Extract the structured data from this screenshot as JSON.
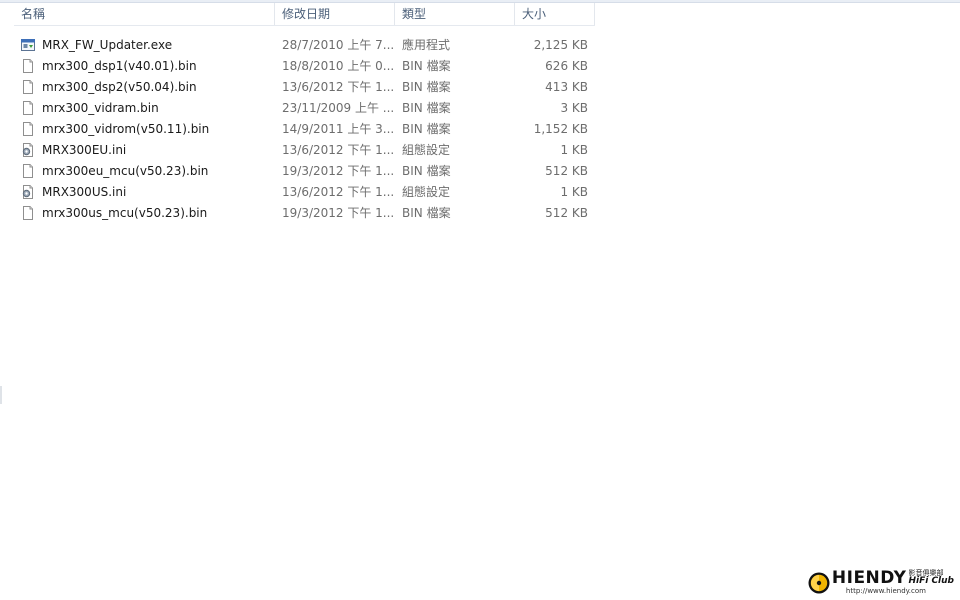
{
  "columns": {
    "name": "名稱",
    "date": "修改日期",
    "type": "類型",
    "size": "大小",
    "sort_indicator": "^"
  },
  "files": [
    {
      "name": "MRX_FW_Updater.exe",
      "date": "28/7/2010 上午 7...",
      "type": "應用程式",
      "size": "2,125 KB",
      "icon": "exe-icon"
    },
    {
      "name": "mrx300_dsp1(v40.01).bin",
      "date": "18/8/2010 上午 0...",
      "type": "BIN 檔案",
      "size": "626 KB",
      "icon": "file-icon"
    },
    {
      "name": "mrx300_dsp2(v50.04).bin",
      "date": "13/6/2012 下午 1...",
      "type": "BIN 檔案",
      "size": "413 KB",
      "icon": "file-icon"
    },
    {
      "name": "mrx300_vidram.bin",
      "date": "23/11/2009 上午 ...",
      "type": "BIN 檔案",
      "size": "3 KB",
      "icon": "file-icon"
    },
    {
      "name": "mrx300_vidrom(v50.11).bin",
      "date": "14/9/2011 上午 3...",
      "type": "BIN 檔案",
      "size": "1,152 KB",
      "icon": "file-icon"
    },
    {
      "name": "MRX300EU.ini",
      "date": "13/6/2012 下午 1...",
      "type": "組態設定",
      "size": "1 KB",
      "icon": "settings-file-icon"
    },
    {
      "name": "mrx300eu_mcu(v50.23).bin",
      "date": "19/3/2012 下午 1...",
      "type": "BIN 檔案",
      "size": "512 KB",
      "icon": "file-icon"
    },
    {
      "name": "MRX300US.ini",
      "date": "13/6/2012 下午 1...",
      "type": "組態設定",
      "size": "1 KB",
      "icon": "settings-file-icon"
    },
    {
      "name": "mrx300us_mcu(v50.23).bin",
      "date": "19/3/2012 下午 1...",
      "type": "BIN 檔案",
      "size": "512 KB",
      "icon": "file-icon"
    }
  ],
  "watermark": {
    "brand": "HIENDY",
    "chinese": "影音俱樂部",
    "club": "HiFi Club",
    "url": "http://www.hiendy.com"
  },
  "colors": {
    "header_text": "#4c607a",
    "detail_text": "#6d6d6d",
    "sort_arrow": "#6d8fb6",
    "logo_yellow": "#f0b400"
  }
}
